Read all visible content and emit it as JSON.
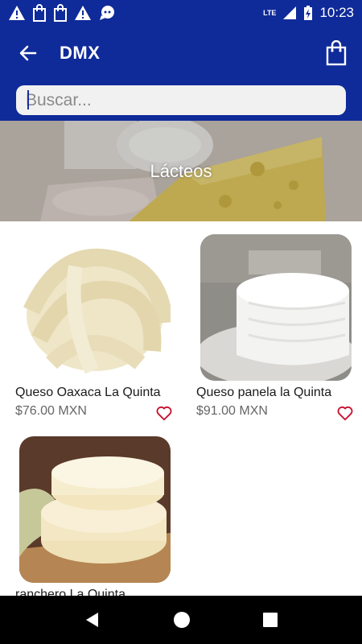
{
  "status_bar": {
    "time": "10:23",
    "network": "LTE",
    "icons": [
      "warning-icon",
      "shopping-bag-icon",
      "shopping-bag-icon",
      "warning-icon",
      "chat-icon",
      "signal-icon",
      "battery-charging-icon"
    ]
  },
  "app_bar": {
    "title": "DMX",
    "back_icon": "arrow-left-icon",
    "cart_icon": "shopping-bag-icon"
  },
  "search": {
    "placeholder": "Buscar...",
    "value": ""
  },
  "banner": {
    "title": "Lácteos"
  },
  "products": [
    {
      "name": "Queso Oaxaca La Quinta",
      "price": "$76.00 MXN",
      "favorite_icon": "heart-outline-icon"
    },
    {
      "name": "Queso panela la Quinta",
      "price": "$91.00 MXN",
      "favorite_icon": "heart-outline-icon"
    },
    {
      "name": "ranchero La Quinta",
      "price": "",
      "favorite_icon": ""
    }
  ],
  "colors": {
    "primary": "#0f2a99",
    "favorite": "#c8102e",
    "nav_bar": "#000000"
  },
  "nav": {
    "icons": [
      "back-triangle-icon",
      "home-circle-icon",
      "recents-square-icon"
    ]
  }
}
